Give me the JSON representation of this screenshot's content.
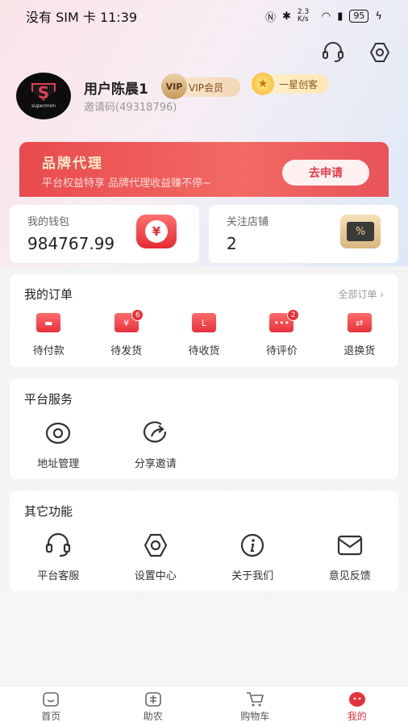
{
  "status_bar": {
    "carrier_time": "没有 SIM 卡 11:39",
    "net_speed": "2.3 K/s",
    "battery": "95"
  },
  "profile": {
    "username": "用户陈晨1",
    "invite_code": "邀请码(49318796)",
    "avatar_text": "supermon",
    "vip_label": "VIP会员",
    "vip_icon_text": "VIP",
    "star_label": "一星创客"
  },
  "brand": {
    "title": "品牌代理",
    "subtitle": "平台权益特享 品牌代理收益赚不停~",
    "apply_button": "去申请"
  },
  "wallet": {
    "label": "我的钱包",
    "value": "984767.99"
  },
  "follow_shops": {
    "label": "关注店铺",
    "value": "2"
  },
  "orders": {
    "title": "我的订单",
    "all_label": "全部订单",
    "items": [
      {
        "label": "待付款",
        "badge": ""
      },
      {
        "label": "待发货",
        "badge": "6"
      },
      {
        "label": "待收货",
        "badge": ""
      },
      {
        "label": "待评价",
        "badge": "2"
      },
      {
        "label": "退换货",
        "badge": ""
      }
    ]
  },
  "services": {
    "title": "平台服务",
    "items": [
      {
        "label": "地址管理",
        "icon": "location-icon"
      },
      {
        "label": "分享邀请",
        "icon": "share-icon"
      }
    ]
  },
  "others": {
    "title": "其它功能",
    "items": [
      {
        "label": "平台客服",
        "icon": "headset-icon"
      },
      {
        "label": "设置中心",
        "icon": "gear-icon"
      },
      {
        "label": "关于我们",
        "icon": "info-icon"
      },
      {
        "label": "意见反馈",
        "icon": "mail-icon"
      }
    ]
  },
  "tabbar": {
    "items": [
      {
        "label": "首页",
        "icon": "home-icon"
      },
      {
        "label": "助农",
        "icon": "farm-icon"
      },
      {
        "label": "购物车",
        "icon": "cart-icon"
      },
      {
        "label": "我的",
        "icon": "me-icon"
      }
    ],
    "active_color": "#e6313b"
  },
  "colors": {
    "accent": "#e6313b",
    "banner": "#ee5558"
  }
}
